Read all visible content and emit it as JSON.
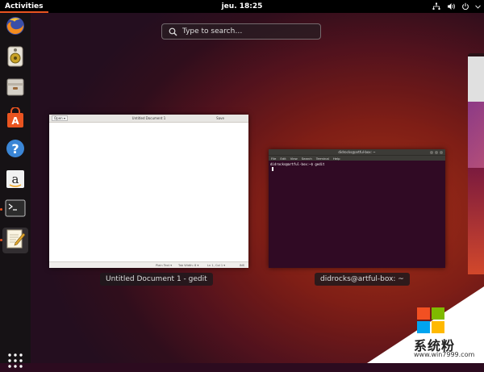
{
  "topbar": {
    "activities": "Activities",
    "clock": "jeu. 18:25",
    "tray_icons": [
      "network-icon",
      "volume-icon",
      "power-icon"
    ]
  },
  "search": {
    "placeholder": "Type to search…"
  },
  "dock": {
    "items": [
      {
        "name": "firefox",
        "running": false
      },
      {
        "name": "rhythmbox",
        "running": false
      },
      {
        "name": "files",
        "running": false
      },
      {
        "name": "software",
        "running": false
      },
      {
        "name": "help",
        "running": false
      },
      {
        "name": "amazon",
        "running": false
      },
      {
        "name": "terminal",
        "running": true
      },
      {
        "name": "gedit",
        "running": true
      }
    ]
  },
  "windows": {
    "gedit": {
      "caption": "Untitled Document 1 - gedit",
      "title": "Untitled Document 1",
      "open_label": "Open ▾",
      "save_label": "Save",
      "status_plain": "Plain Text ▾",
      "status_tab": "Tab Width: 8 ▾",
      "status_pos": "Ln 1, Col 1 ▾",
      "status_ins": "INS"
    },
    "terminal": {
      "caption": "didrocks@artful-box: ~",
      "title": "didrocks@artful-box: ~",
      "menu": [
        "File",
        "Edit",
        "View",
        "Search",
        "Terminal",
        "Help"
      ],
      "prompt": "didrocks@artful-box:~$ gedit"
    }
  },
  "watermark": {
    "text": "系统粉",
    "url": "www.win7999.com"
  },
  "colors": {
    "accent": "#e95420",
    "terminal_bg": "#300a24"
  }
}
